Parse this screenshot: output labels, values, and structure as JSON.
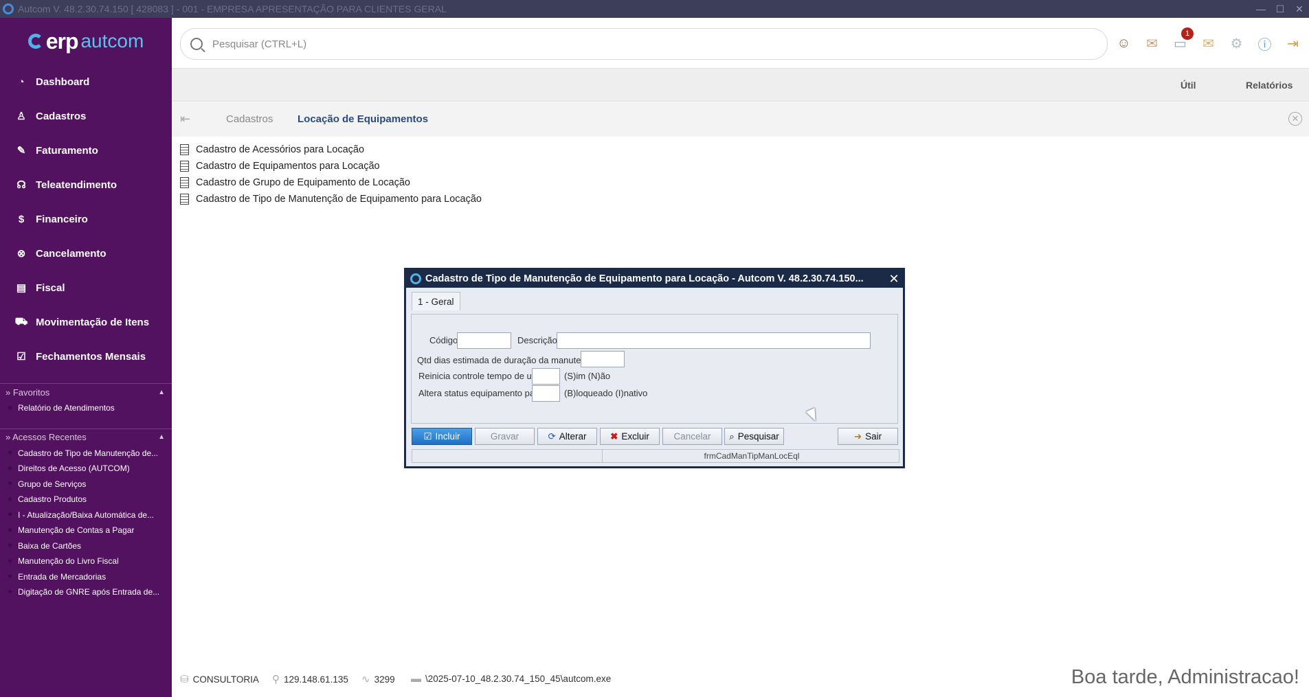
{
  "window": {
    "title": "Autcom V. 48.2.30.74.150 [ 428083 ] - 001 - EMPRESA APRESENTAÇÃO PARA CLIENTES GERAL",
    "minimize": "—",
    "maximize": "☐",
    "close": "✕"
  },
  "logo": {
    "erp": "erp",
    "brand": "autcom"
  },
  "sidebar": {
    "items": [
      {
        "label": "Dashboard",
        "icon": "dashboard-icon",
        "glyph": "◔"
      },
      {
        "label": "Cadastros",
        "icon": "user-add-icon",
        "glyph": "♙"
      },
      {
        "label": "Faturamento",
        "icon": "tag-icon",
        "glyph": "✎"
      },
      {
        "label": "Teleatendimento",
        "icon": "headset-icon",
        "glyph": "☊"
      },
      {
        "label": "Financeiro",
        "icon": "dollar-icon",
        "glyph": "$"
      },
      {
        "label": "Cancelamento",
        "icon": "cancel-icon",
        "glyph": "⊗"
      },
      {
        "label": "Fiscal",
        "icon": "notebook-icon",
        "glyph": "▤"
      },
      {
        "label": "Movimentação de Itens",
        "icon": "truck-icon",
        "glyph": "⛟"
      },
      {
        "label": "Fechamentos Mensais",
        "icon": "calendar-check-icon",
        "glyph": "☑"
      }
    ],
    "favorites": {
      "header": "» Favoritos",
      "items": [
        "Relatório de Atendimentos"
      ]
    },
    "recent": {
      "header": "» Acessos Recentes",
      "items": [
        "Cadastro de Tipo de Manutenção de...",
        "Direitos de Acesso (AUTCOM)",
        "Grupo de Serviços",
        "Cadastro Produtos",
        "I - Atualização/Baixa Automática de...",
        "Manutenção de Contas a Pagar",
        "Baixa de Cartões",
        "Manutenção do Livro Fiscal",
        "Entrada de Mercadorias",
        "Digitação de GNRE após Entrada de..."
      ]
    }
  },
  "search": {
    "placeholder": "Pesquisar (CTRL+L)"
  },
  "notifications": {
    "count": "1"
  },
  "menubar": {
    "util": "Útil",
    "reports": "Relatórios"
  },
  "breadcrumb": {
    "back": "⇤",
    "parent": "Cadastros",
    "current": "Locação de Equipamentos",
    "close": "✕"
  },
  "content": {
    "items": [
      "Cadastro de Acessórios para Locação",
      "Cadastro de Equipamentos para Locação",
      "Cadastro de Grupo de Equipamento de Locação",
      "Cadastro de Tipo de Manutenção de Equipamento para Locação"
    ]
  },
  "dialog": {
    "title": "Cadastro de Tipo de Manutenção de Equipamento para Locação   -   Autcom V. 48.2.30.74.150...",
    "close": "✕",
    "tab": "1 - Geral",
    "fields": {
      "codigo_label": "Código",
      "descricao_label": "Descrição",
      "qtd_label": "Qtd dias estimada de duração da manutenção:",
      "reinicia_label": "Reinicia controle tempo de uso?",
      "reinicia_hint": "(S)im (N)ão",
      "altera_label": "Altera status equipamento para:",
      "altera_hint": "(B)loqueado (I)nativo",
      "codigo_value": "",
      "descricao_value": "",
      "qtd_value": "",
      "reinicia_value": "",
      "altera_value": ""
    },
    "buttons": {
      "incluir": "Incluir",
      "gravar": "Gravar",
      "alterar": "Alterar",
      "excluir": "Excluir",
      "cancelar": "Cancelar",
      "pesquisar": "Pesquisar",
      "sair": "Sair"
    },
    "status": "frmCadManTipManLocEql"
  },
  "footer": {
    "server": "CONSULTORIA",
    "ip": "129.148.61.135",
    "port": "3299",
    "path": "\\2025-07-10_48.2.30.74_150_45\\autcom.exe",
    "greeting": "Boa tarde, Administracao!"
  }
}
